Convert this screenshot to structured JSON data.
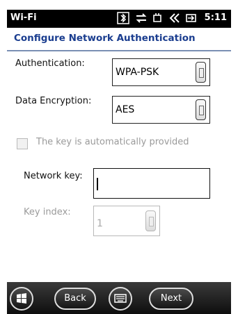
{
  "status_bar": {
    "app_title": "Wi-Fi",
    "time": "5:11",
    "icons": [
      "bluetooth-icon",
      "data-transfer-icon",
      "sync-icon",
      "volume-icon",
      "battery-icon"
    ]
  },
  "header": {
    "title": "Configure Network Authentication"
  },
  "form": {
    "authentication": {
      "label": "Authentication:",
      "value": "WPA-PSK"
    },
    "encryption": {
      "label": "Data Encryption:",
      "value": "AES"
    },
    "auto_key": {
      "label": "The key is automatically provided",
      "checked": false,
      "enabled": false
    },
    "network_key": {
      "label": "Network key:",
      "value": ""
    },
    "key_index": {
      "label": "Key index:",
      "value": "1",
      "enabled": false
    }
  },
  "bottom_bar": {
    "back_label": "Back",
    "next_label": "Next"
  }
}
